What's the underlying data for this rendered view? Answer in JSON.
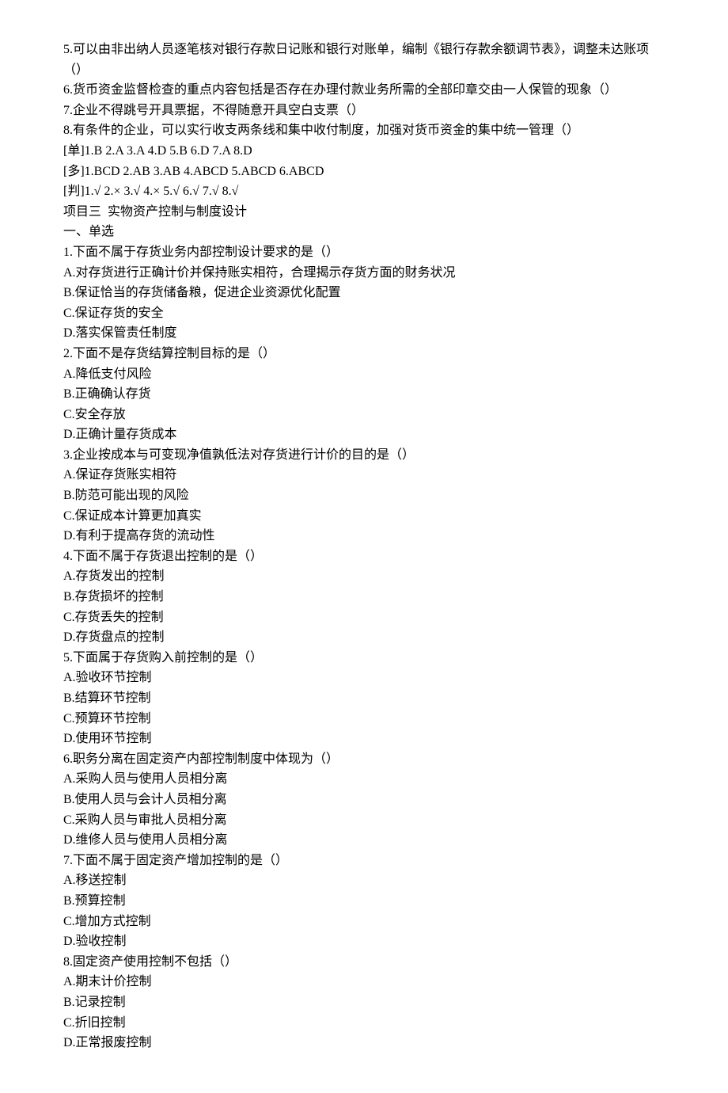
{
  "lines": [
    "5.可以由非出纳人员逐笔核对银行存款日记账和银行对账单，编制《银行存款余额调节表》，调整未达账项（）",
    "6.货币资金监督检查的重点内容包括是否存在办理付款业务所需的全部印章交由一人保管的现象（）",
    "7.企业不得跳号开具票据，不得随意开具空白支票（）",
    "8.有条件的企业，可以实行收支两条线和集中收付制度，加强对货币资金的集中统一管理（）",
    "[单]1.B 2.A 3.A 4.D 5.B 6.D 7.A 8.D",
    "[多]1.BCD 2.AB 3.AB 4.ABCD 5.ABCD 6.ABCD",
    "[判]1.√ 2.× 3.√ 4.× 5.√ 6.√ 7.√ 8.√",
    "项目三  实物资产控制与制度设计",
    "一、单选",
    "1.下面不属于存货业务内部控制设计要求的是（）",
    "A.对存货进行正确计价并保持账实相符，合理揭示存货方面的财务状况",
    "B.保证恰当的存货储备粮，促进企业资源优化配置",
    "C.保证存货的安全",
    "D.落实保管责任制度",
    "2.下面不是存货结算控制目标的是（）",
    "A.降低支付风险",
    "B.正确确认存货",
    "C.安全存放",
    "D.正确计量存货成本",
    "3.企业按成本与可变现净值孰低法对存货进行计价的目的是（）",
    "A.保证存货账实相符",
    "B.防范可能出现的风险",
    "C.保证成本计算更加真实",
    "D.有利于提高存货的流动性",
    "4.下面不属于存货退出控制的是（）",
    "A.存货发出的控制",
    "B.存货损坏的控制",
    "C.存货丢失的控制",
    "D.存货盘点的控制",
    "5.下面属于存货购入前控制的是（）",
    "A.验收环节控制",
    "B.结算环节控制",
    "C.预算环节控制",
    "D.使用环节控制",
    "6.职务分离在固定资产内部控制制度中体现为（）",
    "A.采购人员与使用人员相分离",
    "B.使用人员与会计人员相分离",
    "C.采购人员与审批人员相分离",
    "D.维修人员与使用人员相分离",
    "7.下面不属于固定资产增加控制的是（）",
    "A.移送控制",
    "B.预算控制",
    "C.增加方式控制",
    "D.验收控制",
    "8.固定资产使用控制不包括（）",
    "A.期末计价控制",
    "B.记录控制",
    "C.折旧控制",
    "D.正常报废控制"
  ]
}
